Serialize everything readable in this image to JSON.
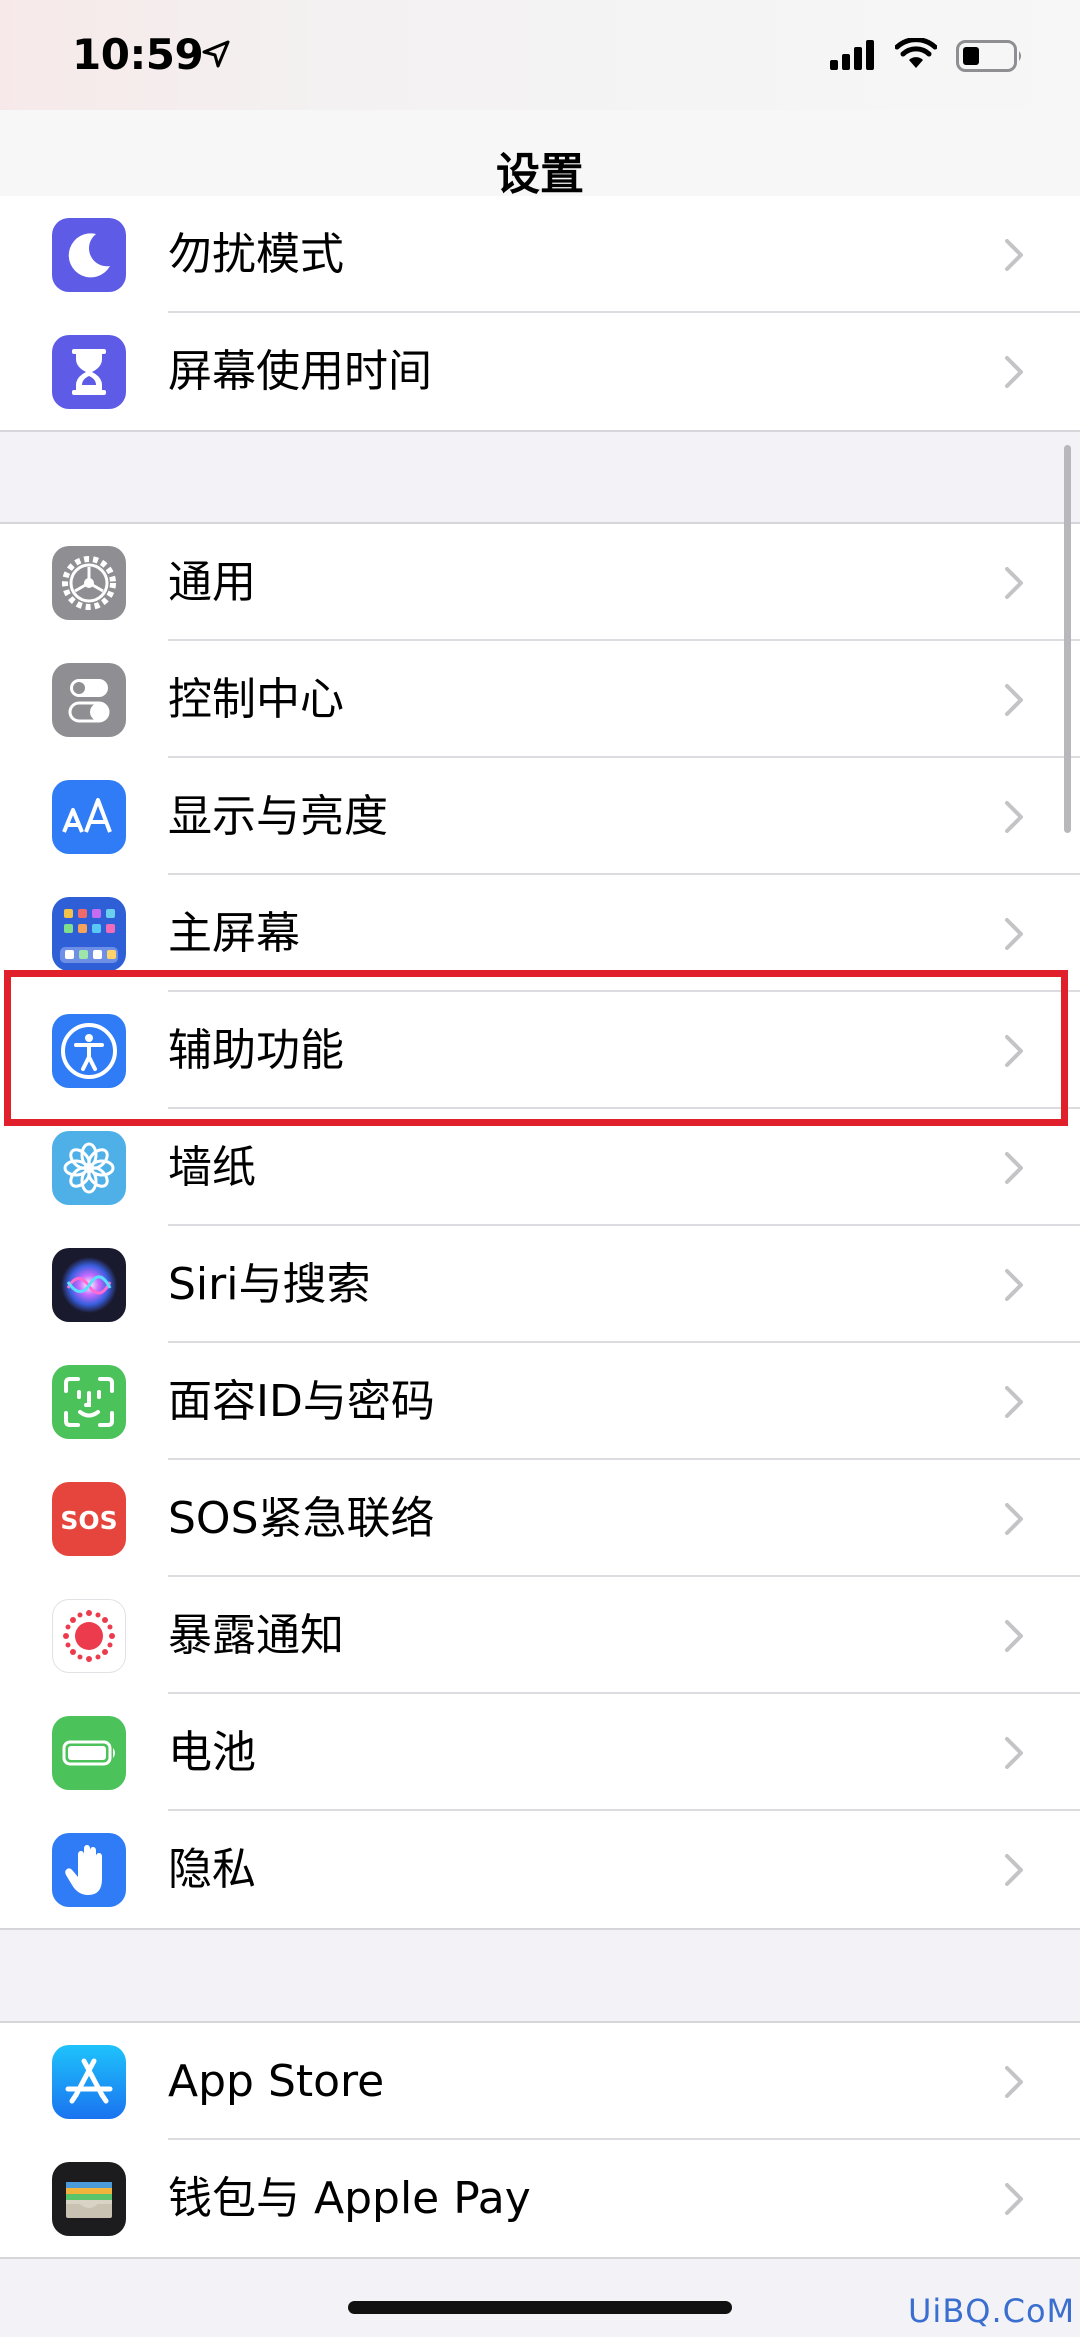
{
  "status": {
    "time": "10:59"
  },
  "nav": {
    "title": "设置"
  },
  "group1": [
    {
      "label": "勿扰模式",
      "icon": "moon-icon",
      "color": "#5e5ce6"
    },
    {
      "label": "屏幕使用时间",
      "icon": "hourglass-icon",
      "color": "#5e5ce6"
    }
  ],
  "group2": [
    {
      "label": "通用",
      "icon": "gear-icon",
      "color": "#8e8e93"
    },
    {
      "label": "控制中心",
      "icon": "toggles-icon",
      "color": "#8e8e93"
    },
    {
      "label": "显示与亮度",
      "icon": "text-size-icon",
      "color": "#2f7cf6"
    },
    {
      "label": "主屏幕",
      "icon": "home-screen-icon",
      "color": "#2f5fd6"
    },
    {
      "label": "辅助功能",
      "icon": "accessibility-icon",
      "color": "#2f7cf6"
    },
    {
      "label": "墙纸",
      "icon": "flower-icon",
      "color": "#4fb0e8"
    },
    {
      "label": "Siri与搜索",
      "icon": "siri-icon",
      "color": "#1a1a2e"
    },
    {
      "label": "面容ID与密码",
      "icon": "face-id-icon",
      "color": "#4cc25a"
    },
    {
      "label": "SOS紧急联络",
      "icon": "sos-icon",
      "color": "#e5453c"
    },
    {
      "label": "暴露通知",
      "icon": "exposure-icon",
      "color": "#ffffff"
    },
    {
      "label": "电池",
      "icon": "battery-icon",
      "color": "#4cc25a"
    },
    {
      "label": "隐私",
      "icon": "hand-icon",
      "color": "#2f7cf6"
    }
  ],
  "group3": [
    {
      "label": "App Store",
      "icon": "app-store-icon",
      "color": "#2f8cf6"
    },
    {
      "label": "钱包与 Apple Pay",
      "icon": "wallet-icon",
      "color": "#1c1c1e"
    }
  ],
  "icons": {
    "sos_text": "SOS"
  },
  "watermark": "UiBQ.CoM",
  "highlight_color": "#e0202a"
}
